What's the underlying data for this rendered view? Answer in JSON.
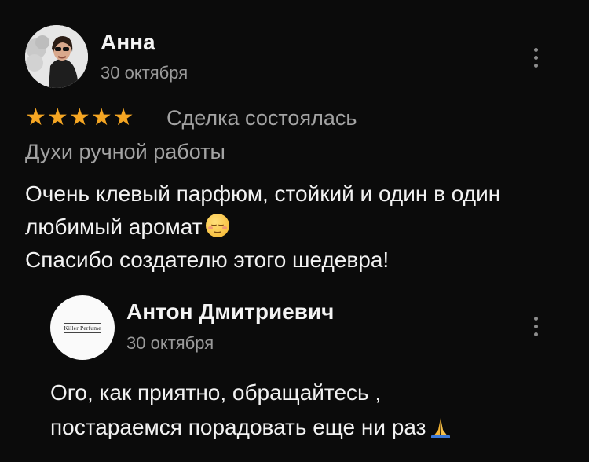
{
  "review": {
    "author": {
      "name": "Анна",
      "date": "30 октября"
    },
    "rating": 5,
    "status": "Сделка состоялась",
    "product": "Духи ручной работы",
    "text_lines": [
      "Очень клевый парфюм, стойкий и один в один",
      "любимый аромат",
      "Спасибо создателю этого шедевра!"
    ],
    "emoji": "relieved-face"
  },
  "reply": {
    "author": {
      "name": "Антон Дмитриевич",
      "date": "30 октября",
      "logo_text": "Killer Perfume"
    },
    "text_lines": [
      "Ого, как приятно, обращайтесь ,",
      "постараемся порадовать еще ни раз"
    ],
    "emoji": "folded-hands"
  },
  "colors": {
    "star": "#f5a623",
    "background": "#0b0b0b",
    "muted": "#9a9a9a"
  }
}
